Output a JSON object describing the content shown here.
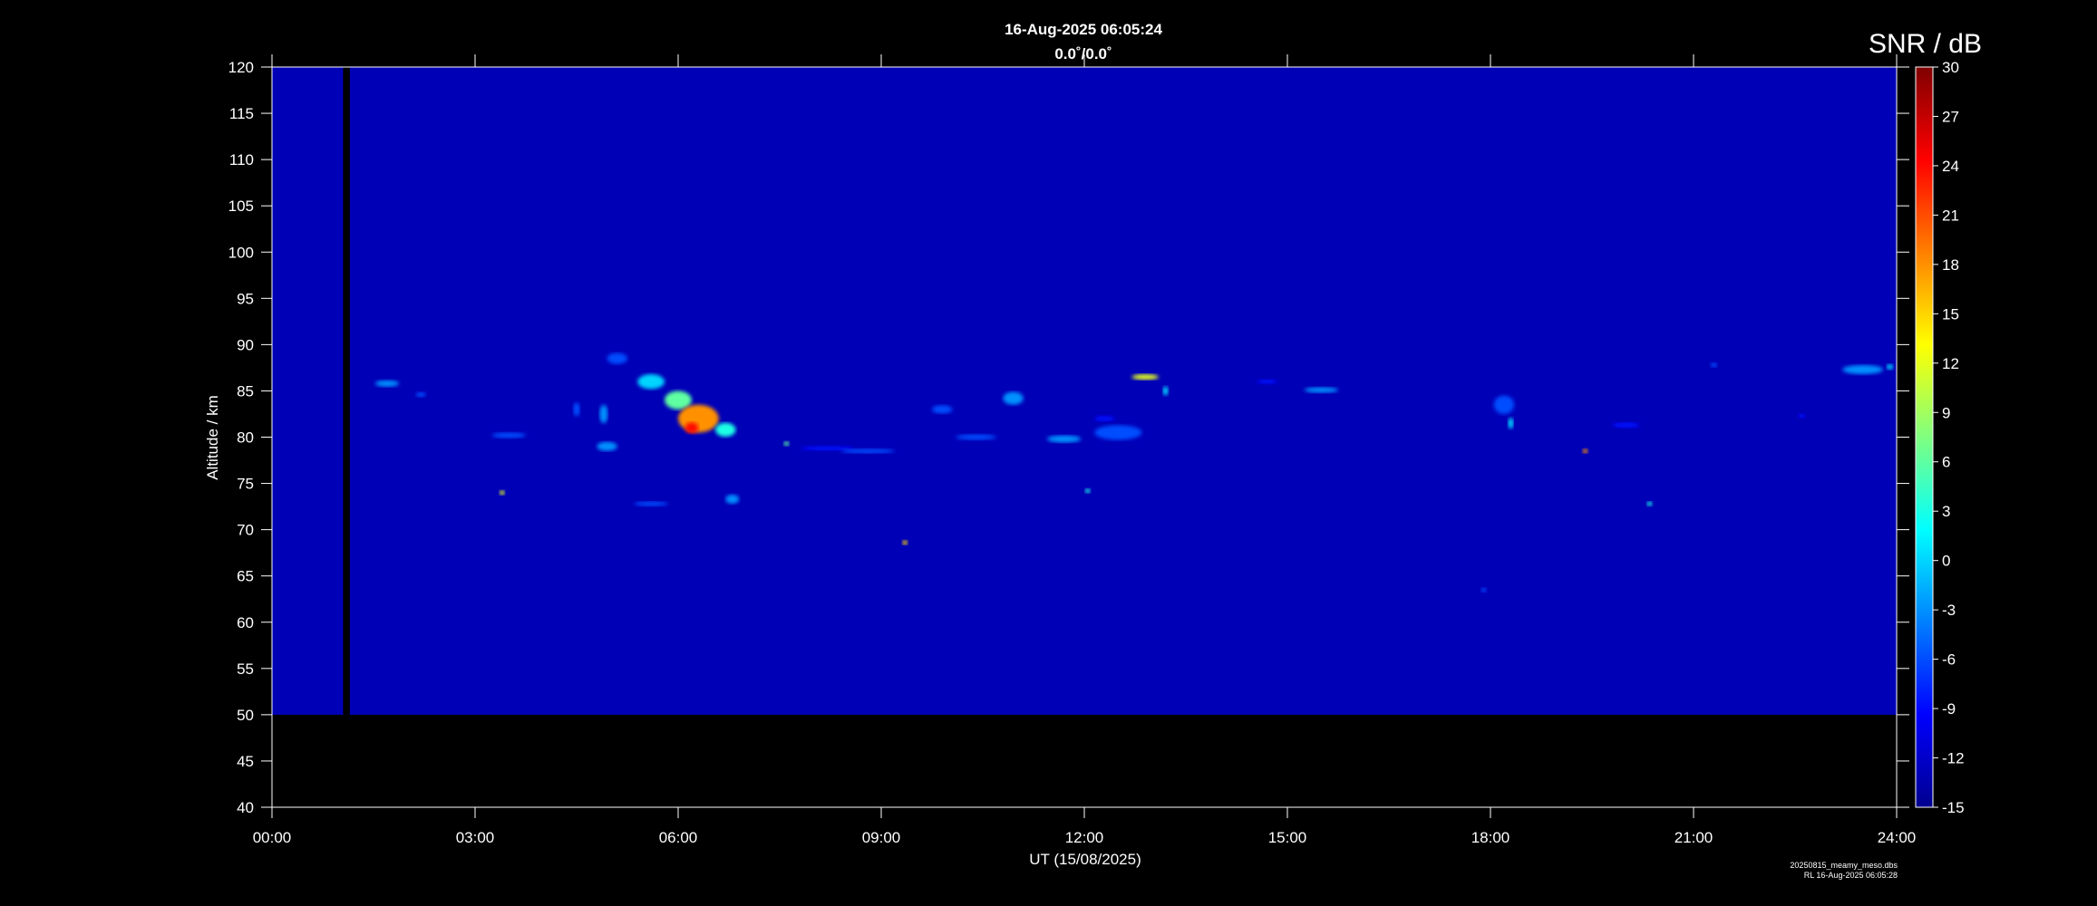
{
  "chart_data": {
    "type": "heatmap",
    "title": "16-Aug-2025 06:05:24",
    "subtitle": "0.0˚/0.0˚",
    "xlabel": "UT (15/08/2025)",
    "ylabel": "Altitude / km",
    "colorbar_label": "SNR / dB",
    "xlim": [
      0,
      24
    ],
    "ylim": [
      40,
      120
    ],
    "data_ylim": [
      50,
      120
    ],
    "clim": [
      -15,
      30
    ],
    "x_ticks": [
      {
        "value": 0,
        "label": "00:00"
      },
      {
        "value": 3,
        "label": "03:00"
      },
      {
        "value": 6,
        "label": "06:00"
      },
      {
        "value": 9,
        "label": "09:00"
      },
      {
        "value": 12,
        "label": "12:00"
      },
      {
        "value": 15,
        "label": "15:00"
      },
      {
        "value": 18,
        "label": "18:00"
      },
      {
        "value": 21,
        "label": "21:00"
      },
      {
        "value": 24,
        "label": "24:00"
      }
    ],
    "y_ticks": [
      {
        "value": 40,
        "label": "40"
      },
      {
        "value": 45,
        "label": "45"
      },
      {
        "value": 50,
        "label": "50"
      },
      {
        "value": 55,
        "label": "55"
      },
      {
        "value": 60,
        "label": "60"
      },
      {
        "value": 65,
        "label": "65"
      },
      {
        "value": 70,
        "label": "70"
      },
      {
        "value": 75,
        "label": "75"
      },
      {
        "value": 80,
        "label": "80"
      },
      {
        "value": 85,
        "label": "85"
      },
      {
        "value": 90,
        "label": "90"
      },
      {
        "value": 95,
        "label": "95"
      },
      {
        "value": 100,
        "label": "100"
      },
      {
        "value": 105,
        "label": "105"
      },
      {
        "value": 110,
        "label": "110"
      },
      {
        "value": 115,
        "label": "115"
      },
      {
        "value": 120,
        "label": "120"
      }
    ],
    "colorbar_ticks": [
      {
        "value": 30,
        "label": "30"
      },
      {
        "value": 27,
        "label": "27"
      },
      {
        "value": 24,
        "label": "24"
      },
      {
        "value": 21,
        "label": "21"
      },
      {
        "value": 18,
        "label": "18"
      },
      {
        "value": 15,
        "label": "15"
      },
      {
        "value": 12,
        "label": "12"
      },
      {
        "value": 9,
        "label": "9"
      },
      {
        "value": 6,
        "label": "6"
      },
      {
        "value": 3,
        "label": "3"
      },
      {
        "value": 0,
        "label": "0"
      },
      {
        "value": -3,
        "label": "-3"
      },
      {
        "value": -6,
        "label": "-6"
      },
      {
        "value": -9,
        "label": "-9"
      },
      {
        "value": -12,
        "label": "-12"
      },
      {
        "value": -15,
        "label": "-15"
      }
    ],
    "background_snr": -13,
    "data_gap": {
      "x": [
        1.05,
        1.15
      ]
    },
    "echoes": [
      {
        "x": 1.7,
        "y": 85.8,
        "w": 0.35,
        "h": 0.7,
        "snr": -3
      },
      {
        "x": 2.2,
        "y": 84.6,
        "w": 0.15,
        "h": 0.5,
        "snr": -6
      },
      {
        "x": 3.5,
        "y": 80.2,
        "w": 0.5,
        "h": 0.6,
        "snr": -6
      },
      {
        "x": 3.4,
        "y": 74.0,
        "w": 0.06,
        "h": 0.5,
        "snr": 12
      },
      {
        "x": 4.5,
        "y": 83.0,
        "w": 0.1,
        "h": 1.5,
        "snr": -6
      },
      {
        "x": 4.9,
        "y": 82.5,
        "w": 0.12,
        "h": 2.0,
        "snr": -3
      },
      {
        "x": 4.95,
        "y": 79.0,
        "w": 0.3,
        "h": 1.0,
        "snr": -3
      },
      {
        "x": 5.1,
        "y": 88.5,
        "w": 0.3,
        "h": 1.2,
        "snr": -6
      },
      {
        "x": 5.6,
        "y": 86.0,
        "w": 0.4,
        "h": 1.6,
        "snr": 0
      },
      {
        "x": 6.0,
        "y": 84.0,
        "w": 0.4,
        "h": 2.0,
        "snr": 6
      },
      {
        "x": 6.3,
        "y": 82.0,
        "w": 0.6,
        "h": 3.0,
        "snr": 18
      },
      {
        "x": 6.2,
        "y": 81.0,
        "w": 0.2,
        "h": 1.2,
        "snr": 24
      },
      {
        "x": 6.7,
        "y": 80.8,
        "w": 0.3,
        "h": 1.5,
        "snr": 3
      },
      {
        "x": 5.6,
        "y": 72.8,
        "w": 0.5,
        "h": 0.4,
        "snr": -6
      },
      {
        "x": 6.8,
        "y": 73.3,
        "w": 0.2,
        "h": 1.0,
        "snr": -3
      },
      {
        "x": 8.2,
        "y": 78.8,
        "w": 0.8,
        "h": 0.4,
        "snr": -9
      },
      {
        "x": 8.8,
        "y": 78.5,
        "w": 0.8,
        "h": 0.5,
        "snr": -6
      },
      {
        "x": 9.9,
        "y": 83.0,
        "w": 0.3,
        "h": 0.9,
        "snr": -6
      },
      {
        "x": 10.4,
        "y": 80.0,
        "w": 0.6,
        "h": 0.6,
        "snr": -6
      },
      {
        "x": 10.95,
        "y": 84.2,
        "w": 0.3,
        "h": 1.4,
        "snr": -3
      },
      {
        "x": 11.7,
        "y": 79.8,
        "w": 0.5,
        "h": 0.8,
        "snr": -3
      },
      {
        "x": 12.5,
        "y": 80.5,
        "w": 0.7,
        "h": 1.6,
        "snr": -6
      },
      {
        "x": 12.3,
        "y": 82.0,
        "w": 0.3,
        "h": 0.6,
        "snr": -9
      },
      {
        "x": 12.9,
        "y": 86.5,
        "w": 0.4,
        "h": 0.6,
        "snr": 12
      },
      {
        "x": 13.2,
        "y": 85.0,
        "w": 0.06,
        "h": 1.0,
        "snr": 0
      },
      {
        "x": 15.5,
        "y": 85.1,
        "w": 0.5,
        "h": 0.6,
        "snr": -3
      },
      {
        "x": 14.7,
        "y": 86.0,
        "w": 0.3,
        "h": 0.4,
        "snr": -9
      },
      {
        "x": 18.2,
        "y": 83.5,
        "w": 0.3,
        "h": 2.0,
        "snr": -6
      },
      {
        "x": 18.3,
        "y": 81.5,
        "w": 0.08,
        "h": 1.2,
        "snr": 0
      },
      {
        "x": 20.0,
        "y": 81.3,
        "w": 0.4,
        "h": 0.6,
        "snr": -9
      },
      {
        "x": 23.5,
        "y": 87.3,
        "w": 0.6,
        "h": 1.0,
        "snr": -3
      },
      {
        "x": 23.9,
        "y": 87.6,
        "w": 0.1,
        "h": 0.6,
        "snr": 0
      },
      {
        "x": 9.35,
        "y": 68.6,
        "w": 0.05,
        "h": 0.4,
        "snr": 15
      },
      {
        "x": 19.4,
        "y": 78.5,
        "w": 0.05,
        "h": 0.4,
        "snr": 18
      },
      {
        "x": 20.35,
        "y": 72.8,
        "w": 0.05,
        "h": 0.4,
        "snr": 3
      },
      {
        "x": 12.05,
        "y": 74.2,
        "w": 0.05,
        "h": 0.4,
        "snr": 3
      },
      {
        "x": 7.6,
        "y": 79.3,
        "w": 0.05,
        "h": 0.4,
        "snr": 6
      },
      {
        "x": 17.9,
        "y": 63.5,
        "w": 0.05,
        "h": 0.4,
        "snr": -6
      },
      {
        "x": 22.6,
        "y": 82.3,
        "w": 0.1,
        "h": 0.4,
        "snr": -9
      },
      {
        "x": 21.3,
        "y": 87.8,
        "w": 0.1,
        "h": 0.3,
        "snr": -6
      }
    ]
  },
  "footer": {
    "file_line": "20250815_meamy_meso.dbs",
    "stamp_line": "RL 16-Aug-2025 06:05:28"
  }
}
